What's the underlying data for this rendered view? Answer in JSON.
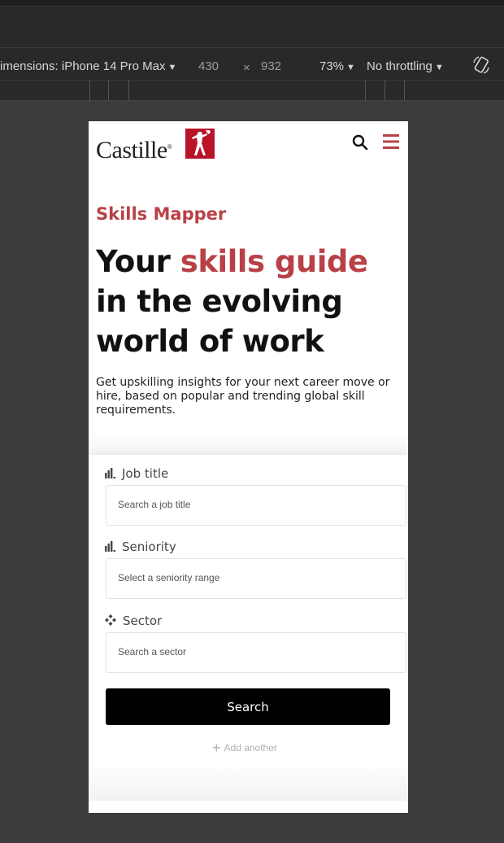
{
  "devtools": {
    "dimensions_label": "imensions: iPhone 14 Pro Max",
    "width": "430",
    "times": "×",
    "height": "932",
    "zoom": "73%",
    "throttling": "No throttling",
    "caret": "▼",
    "rotate_icon": "rotate-icon"
  },
  "site": {
    "logo_text": "Castille",
    "logo_mark": "®",
    "eyebrow": "Skills Mapper",
    "headline_pre": "Your ",
    "headline_accent": "skills guide",
    "headline_post": " in the evolving world of work",
    "intro": "Get upskilling insights for your next career move or hire, based on popular and trending global skill requirements.",
    "brand_red": "#b84147"
  },
  "form": {
    "job_title_label": "Job title",
    "job_title_placeholder": "Search a job title",
    "seniority_label": "Seniority",
    "seniority_placeholder": "Select a seniority range",
    "sector_label": "Sector",
    "sector_placeholder": "Search a sector",
    "search_button": "Search",
    "add_another_plus": "+",
    "add_another": "Add another"
  }
}
